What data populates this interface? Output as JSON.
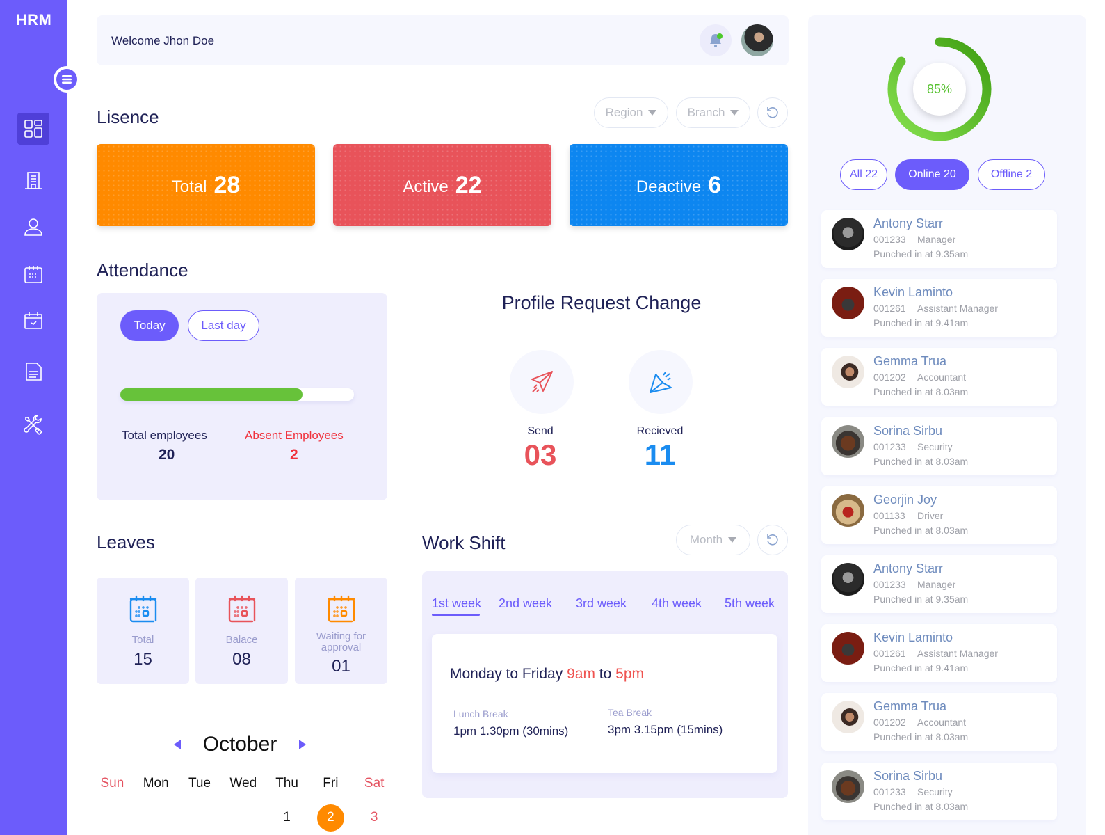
{
  "app": {
    "brand": "HRM"
  },
  "sidebar": {
    "items": [
      {
        "name": "dashboard",
        "icon": "dashboard-grid-icon",
        "active": true
      },
      {
        "name": "company",
        "icon": "building-icon",
        "active": false
      },
      {
        "name": "employees",
        "icon": "user-icon",
        "active": false
      },
      {
        "name": "calendar",
        "icon": "calendar-icon",
        "active": false
      },
      {
        "name": "attendance",
        "icon": "calendar-check-icon",
        "active": false
      },
      {
        "name": "documents",
        "icon": "document-icon",
        "active": false
      },
      {
        "name": "settings",
        "icon": "tools-icon",
        "active": false
      }
    ]
  },
  "header": {
    "welcome": "Welcome Jhon Doe",
    "notification_dot": true
  },
  "licence": {
    "title": "Lisence",
    "filters": {
      "region": "Region",
      "branch": "Branch"
    },
    "cards": [
      {
        "label": "Total",
        "value": "28",
        "color": "#ff8a00"
      },
      {
        "label": "Active",
        "value": "22",
        "color": "#e8535a"
      },
      {
        "label": "Deactive",
        "value": "6",
        "color": "#0d86f0"
      }
    ]
  },
  "attendance": {
    "title": "Attendance",
    "tabs": [
      {
        "label": "Today",
        "active": true
      },
      {
        "label": "Last day",
        "active": false
      }
    ],
    "progress_percent": 78,
    "total_label": "Total employees",
    "total_value": "20",
    "absent_label": "Absent Employees",
    "absent_value": "2"
  },
  "profile_request": {
    "title": "Profile Request Change",
    "send_label": "Send",
    "send_value": "03",
    "received_label": "Recieved",
    "received_value": "11"
  },
  "leaves": {
    "title": "Leaves",
    "cards": [
      {
        "label": "Total",
        "value": "15",
        "color": "#1a8cf0"
      },
      {
        "label": "Balace",
        "value": "08",
        "color": "#e8535a"
      },
      {
        "label": "Waiting for approval",
        "value": "01",
        "color": "#ff8a00"
      }
    ]
  },
  "calendar": {
    "month": "October",
    "weekdays": [
      "Sun",
      "Mon",
      "Tue",
      "Wed",
      "Thu",
      "Fri",
      "Sat"
    ],
    "first_row": [
      "",
      "",
      "",
      "",
      "1",
      "2",
      "3"
    ],
    "today": "2"
  },
  "work_shift": {
    "title": "Work Shift",
    "period_select": "Month",
    "tabs": [
      "1st week",
      "2nd week",
      "3rd week",
      "4th week",
      "5th week"
    ],
    "active_tab": 0,
    "schedule_prefix": "Monday to Friday",
    "start": "9am",
    "to": "to",
    "end": "5pm",
    "lunch_label": "Lunch Break",
    "lunch_value": "1pm 1.30pm (30mins)",
    "tea_label": "Tea Break",
    "tea_value": "3pm 3.15pm (15mins)"
  },
  "presence": {
    "percent": 85,
    "percent_label": "85%",
    "filters": [
      {
        "label": "All 22",
        "active": false
      },
      {
        "label": "Online 20",
        "active": true
      },
      {
        "label": "Offline 2",
        "active": false
      }
    ],
    "employees": [
      {
        "name": "Antony Starr",
        "id": "001233",
        "role": "Manager",
        "punch": "Punched in at 9.35am"
      },
      {
        "name": "Kevin Laminto",
        "id": "001261",
        "role": "Assistant Manager",
        "punch": "Punched in at 9.41am"
      },
      {
        "name": "Gemma Trua",
        "id": "001202",
        "role": "Accountant",
        "punch": "Punched in at 8.03am"
      },
      {
        "name": "Sorina Sirbu",
        "id": "001233",
        "role": "Security",
        "punch": "Punched in at 8.03am"
      },
      {
        "name": "Georjin Joy",
        "id": "001133",
        "role": "Driver",
        "punch": "Punched in at 8.03am"
      },
      {
        "name": "Antony Starr",
        "id": "001233",
        "role": "Manager",
        "punch": "Punched in at 9.35am"
      },
      {
        "name": "Kevin Laminto",
        "id": "001261",
        "role": "Assistant Manager",
        "punch": "Punched in at 9.41am"
      },
      {
        "name": "Gemma Trua",
        "id": "001202",
        "role": "Accountant",
        "punch": "Punched in at 8.03am"
      },
      {
        "name": "Sorina Sirbu",
        "id": "001233",
        "role": "Security",
        "punch": "Punched in at 8.03am"
      }
    ]
  }
}
